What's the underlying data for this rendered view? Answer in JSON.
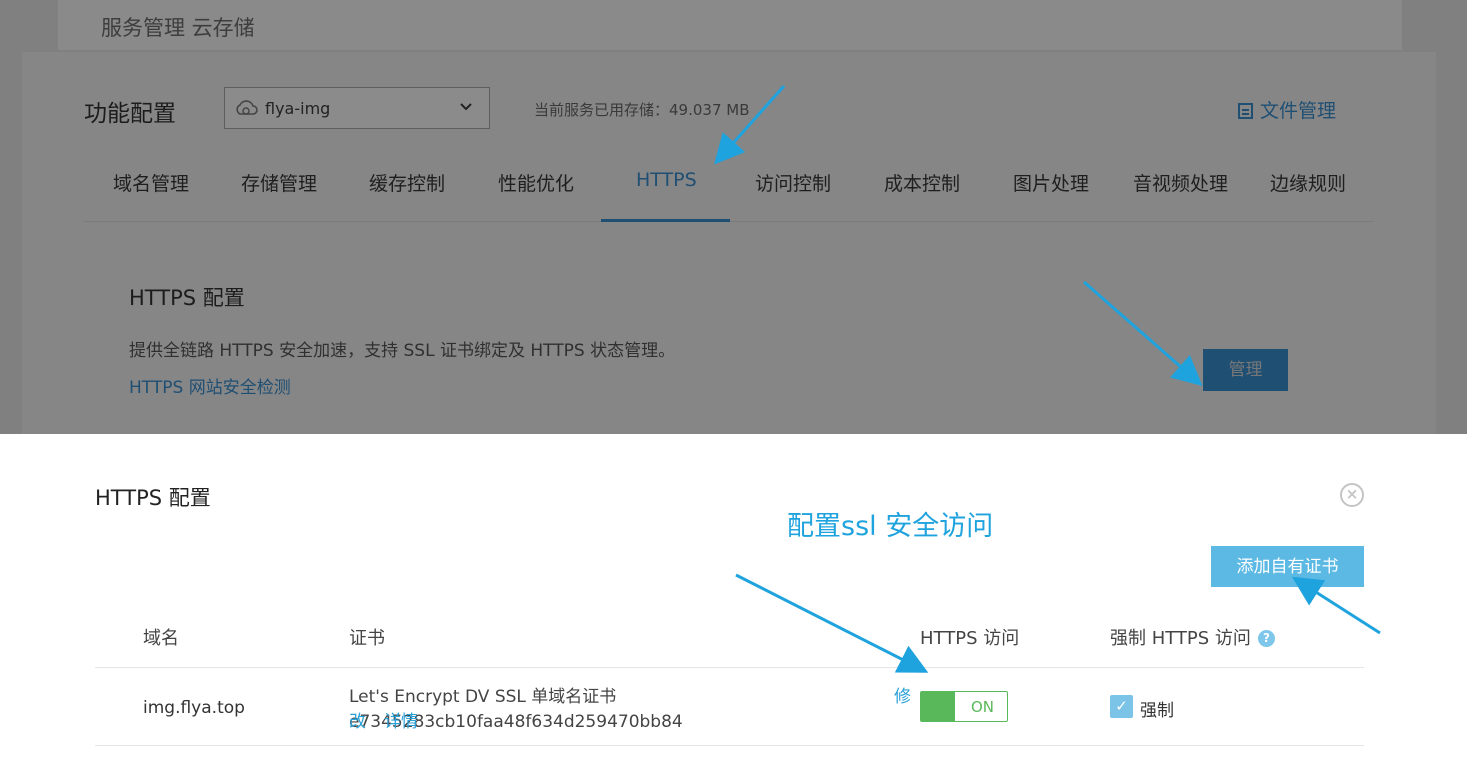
{
  "header": {
    "title": "服务管理 云存储"
  },
  "config": {
    "title": "功能配置",
    "bucket": {
      "name": "flya-img",
      "icon": "cloud-icon",
      "dropdown_icon": "chevron-down-icon"
    },
    "usage": "当前服务已用存储：49.037 MB",
    "file_manage": {
      "label": "文件管理",
      "icon": "file-icon"
    },
    "tabs": [
      {
        "label": "域名管理"
      },
      {
        "label": "存储管理"
      },
      {
        "label": "缓存控制"
      },
      {
        "label": "性能优化"
      },
      {
        "label": "HTTPS",
        "active": true
      },
      {
        "label": "访问控制"
      },
      {
        "label": "成本控制"
      },
      {
        "label": "图片处理"
      },
      {
        "label": "音视频处理"
      },
      {
        "label": "边缘规则"
      }
    ],
    "https_section": {
      "title": "HTTPS 配置",
      "description": "提供全链路 HTTPS 安全加速，支持 SSL 证书绑定及 HTTPS 状态管理。",
      "link": "HTTPS 网站安全检测",
      "manage_button": "管理"
    }
  },
  "modal": {
    "title": "HTTPS 配置",
    "close_icon": "close-circle-icon",
    "annotation": "配置ssl 安全访问",
    "add_cert_button": "添加自有证书",
    "columns": [
      "域名",
      "证书",
      "HTTPS 访问",
      "强制 HTTPS 访问"
    ],
    "help_icon": "question-circle-icon",
    "help_glyph": "?",
    "rows": [
      {
        "domain": "img.flya.top",
        "certificate": "Let's Encrypt DV SSL 单域名证书 e7345283cb10faa48f634d259470bb84",
        "action_modify_part1": "修",
        "action_modify_part2": "改",
        "action_detail": "详情",
        "https_toggle": "ON",
        "force_label": "强制",
        "force_checked": true
      }
    ]
  },
  "colors": {
    "accent": "#1fa3de",
    "button_blue": "#5bb9e4",
    "toggle_green": "#59b95a",
    "overlay_link": "#1f4f73"
  }
}
